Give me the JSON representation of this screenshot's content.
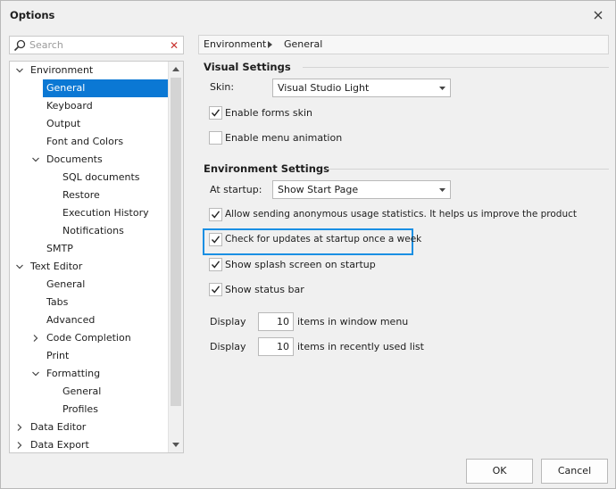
{
  "window": {
    "title": "Options"
  },
  "search": {
    "placeholder": "Search"
  },
  "tree": [
    {
      "label": "Environment",
      "arrow": "down"
    },
    {
      "label": "General",
      "selected": true
    },
    {
      "label": "Keyboard"
    },
    {
      "label": "Output"
    },
    {
      "label": "Font and Colors"
    },
    {
      "label": "Documents",
      "arrow": "down"
    },
    {
      "label": "SQL documents"
    },
    {
      "label": "Restore"
    },
    {
      "label": "Execution History"
    },
    {
      "label": "Notifications"
    },
    {
      "label": "SMTP"
    },
    {
      "label": "Text Editor",
      "arrow": "down"
    },
    {
      "label": "General"
    },
    {
      "label": "Tabs"
    },
    {
      "label": "Advanced"
    },
    {
      "label": "Code Completion",
      "arrow": "right"
    },
    {
      "label": "Print"
    },
    {
      "label": "Formatting",
      "arrow": "down"
    },
    {
      "label": "General"
    },
    {
      "label": "Profiles"
    },
    {
      "label": "Data Editor",
      "arrow": "right"
    },
    {
      "label": "Data Export",
      "arrow": "right"
    }
  ],
  "breadcrumb": {
    "item1": "Environment",
    "item2": "General"
  },
  "visual": {
    "title": "Visual Settings",
    "skin_label": "Skin:",
    "skin_value": "Visual Studio Light",
    "forms_skin": "Enable forms skin",
    "menu_animation": "Enable menu animation"
  },
  "env": {
    "title": "Environment Settings",
    "startup_label": "At startup:",
    "startup_value": "Show Start Page",
    "usage_stats": "Allow sending anonymous usage statistics. It helps us improve the product",
    "check_updates": "Check for updates at startup once a week",
    "splash": "Show splash screen on startup",
    "status_bar": "Show status bar",
    "display1_label": "Display",
    "display1_value": "10",
    "display1_suffix": "items in window menu",
    "display2_label": "Display",
    "display2_value": "10",
    "display2_suffix": "items in recently used list"
  },
  "buttons": {
    "ok": "OK",
    "cancel": "Cancel"
  },
  "colors": {
    "selection": "#0b78d4",
    "highlight_border": "#1a8fe3",
    "clear_icon": "#c8312d"
  }
}
